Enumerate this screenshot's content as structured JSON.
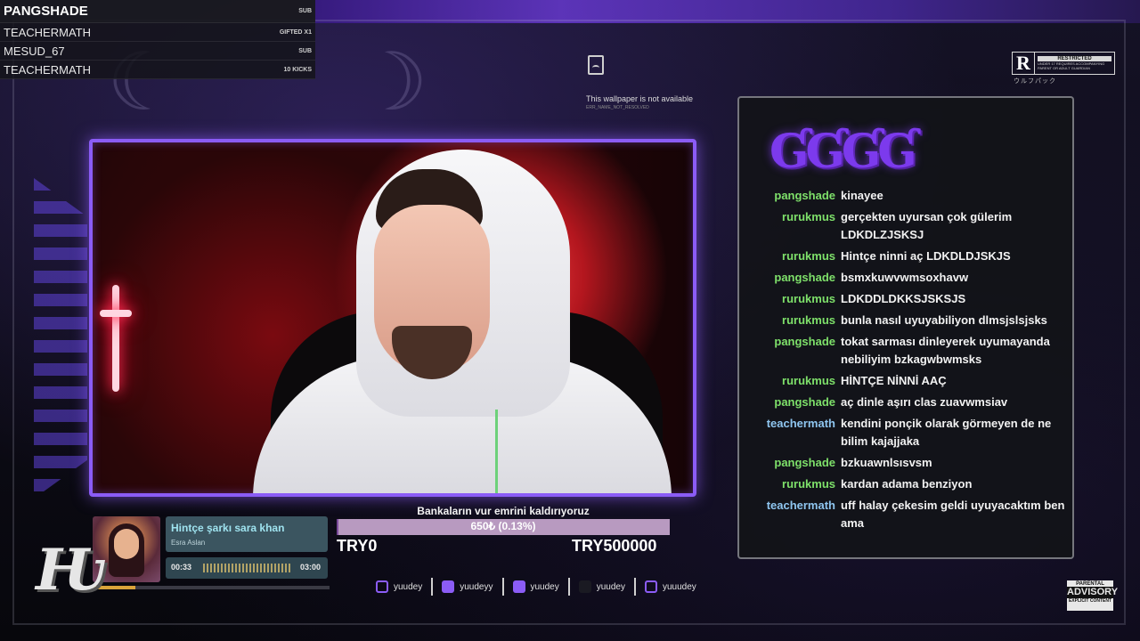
{
  "events": [
    {
      "name": "PANGSHADE",
      "type": "SUB"
    },
    {
      "name": "TEACHERMATH",
      "type": "GIFTED X1"
    },
    {
      "name": "MESUD_67",
      "type": "SUB"
    },
    {
      "name": "TEACHERMATH",
      "type": "10 KICKS"
    }
  ],
  "wallpaper": {
    "message": "This wallpaper is not available",
    "code": "ERR_NAME_NOT_RESOLVED",
    "icon": "broken-file-icon"
  },
  "rating": {
    "letter": "R",
    "title": "RESTRICTED",
    "desc": "UNDER 17 REQUIRES ACCOMPANYING PARENT OR ADULT GUARDIAN",
    "sub": "ウルフパック"
  },
  "chat": {
    "logo": "ƓƓƓƓ",
    "messages": [
      {
        "user": "pangshade",
        "color": "#7ee06a",
        "text": "kinayee"
      },
      {
        "user": "rurukmus",
        "color": "#7ee06a",
        "text": "gerçekten uyursan çok gülerim LDKDLZJSKSJ"
      },
      {
        "user": "rurukmus",
        "color": "#7ee06a",
        "text": "Hintçe ninni aç LDKDLDJSKJS"
      },
      {
        "user": "pangshade",
        "color": "#7ee06a",
        "text": "bsmxkuwvwmsoxhavw"
      },
      {
        "user": "rurukmus",
        "color": "#7ee06a",
        "text": "LDKDDLDKKSJSKSJS"
      },
      {
        "user": "rurukmus",
        "color": "#7ee06a",
        "text": "bunla nasıl uyuyabiliyon dlmsjslsjsks"
      },
      {
        "user": "pangshade",
        "color": "#7ee06a",
        "text": "tokat sarması dinleyerek uyumayanda nebiliyim bzkagwbwmsks"
      },
      {
        "user": "rurukmus",
        "color": "#7ee06a",
        "text": "HİNTÇE NİNNİ AAÇ"
      },
      {
        "user": "pangshade",
        "color": "#7ee06a",
        "text": "aç dinle aşırı clas zuavwmsiav"
      },
      {
        "user": "teachermath",
        "color": "#8fc6f0",
        "text": "kendini ponçik olarak görmeyen de ne bilim kajajjaka"
      },
      {
        "user": "pangshade",
        "color": "#7ee06a",
        "text": "bzkuawnlsısvsm"
      },
      {
        "user": "rurukmus",
        "color": "#7ee06a",
        "text": "kardan adama benziyon"
      },
      {
        "user": "teachermath",
        "color": "#8fc6f0",
        "text": "uff halay çekesim geldi uyuyacaktım ben ama"
      }
    ]
  },
  "music": {
    "title": "Hintçe şarkı sara khan",
    "artist": "Esra Aslan",
    "current": "00:33",
    "total": "03:00",
    "progress": 0.18
  },
  "goal": {
    "title": "Bankaların vur emrini kaldırıyoruz",
    "amount": "650₺ (0.13%)",
    "fraction": 0.0013,
    "min": "TRY0",
    "max": "TRY500000"
  },
  "socials": [
    {
      "icon": "instagram-icon",
      "handle": "yuudey",
      "cls": "ico-ig"
    },
    {
      "icon": "twitter-icon",
      "handle": "yuudeyy",
      "cls": "ico-tw"
    },
    {
      "icon": "youtube-icon",
      "handle": "yuudey",
      "cls": "ico-yt"
    },
    {
      "icon": "tiktok-icon",
      "handle": "yuudey",
      "cls": "ico-tt"
    },
    {
      "icon": "twitch-icon",
      "handle": "yuuudey",
      "cls": "ico-tv"
    }
  ],
  "advisory": {
    "line1": "PARENTAL",
    "line2": "ADVISORY",
    "line3": "EXPLICIT CONTENT"
  },
  "colors": {
    "accent": "#8b5cf6",
    "chat_user_default": "#7ee06a",
    "chat_user_alt": "#8fc6f0"
  }
}
